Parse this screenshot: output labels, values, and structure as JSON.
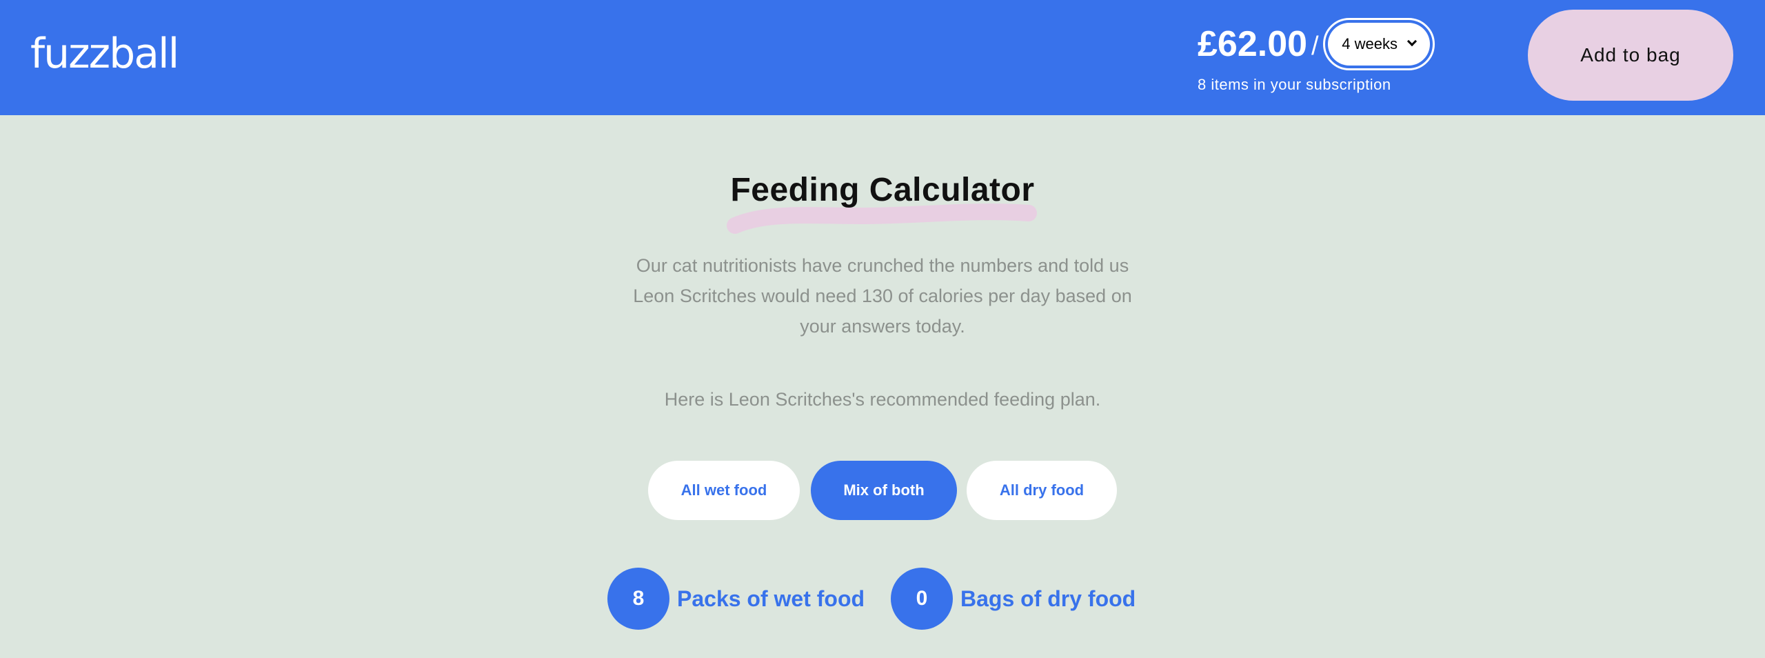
{
  "header": {
    "logo": "fuzzball",
    "price": "£62.00",
    "slash": "/",
    "frequency": "4 weeks",
    "subscription_count": "8 items in your subscription",
    "add_to_bag": "Add to bag"
  },
  "main": {
    "title": "Feeding Calculator",
    "description": "Our cat nutritionists have crunched the numbers and told us Leon Scritches would need 130 of calories per day based on your answers today.",
    "plan_line": "Here is Leon Scritches's recommended feeding plan.",
    "options": [
      {
        "label": "All wet food",
        "selected": false
      },
      {
        "label": "Mix of both",
        "selected": true
      },
      {
        "label": "All dry food",
        "selected": false
      }
    ],
    "counts": [
      {
        "value": "8",
        "label": "Packs of wet food"
      },
      {
        "value": "0",
        "label": "Bags of dry food"
      }
    ]
  },
  "colors": {
    "brand_blue": "#3872eb",
    "background": "#dce6de",
    "accent_pink": "#e8d0e3",
    "muted_text": "#8c918d"
  }
}
